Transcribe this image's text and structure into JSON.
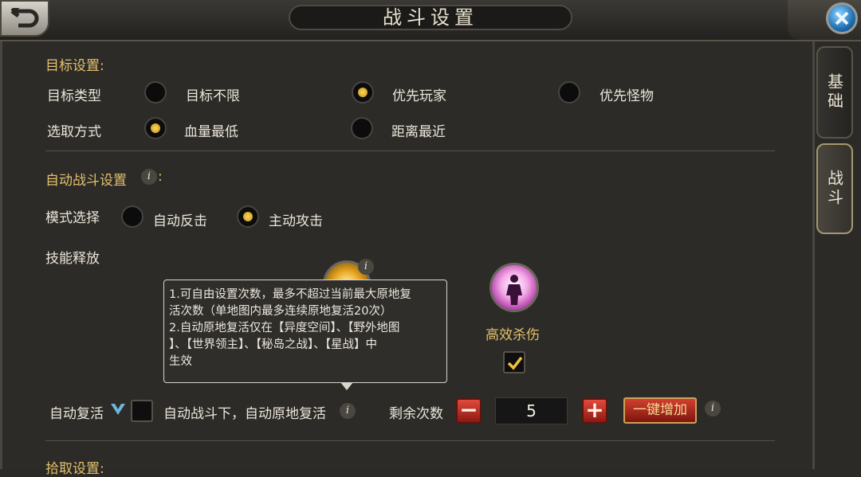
{
  "header": {
    "title": "战斗设置"
  },
  "tabs": [
    {
      "label": "基础",
      "active": false
    },
    {
      "label": "战斗",
      "active": true
    }
  ],
  "target_settings": {
    "heading": "目标设置:",
    "target_type": {
      "label": "目标类型",
      "options": [
        {
          "label": "目标不限",
          "selected": false
        },
        {
          "label": "优先玩家",
          "selected": true
        },
        {
          "label": "优先怪物",
          "selected": false
        }
      ]
    },
    "selection_mode": {
      "label": "选取方式",
      "options": [
        {
          "label": "血量最低",
          "selected": true
        },
        {
          "label": "距离最近",
          "selected": false
        }
      ]
    }
  },
  "auto_battle": {
    "heading": "自动战斗设置",
    "heading_colon": ":",
    "mode": {
      "label": "模式选择",
      "options": [
        {
          "label": "自动反击",
          "selected": false
        },
        {
          "label": "主动攻击",
          "selected": true
        }
      ]
    },
    "skills_label": "技能释放",
    "skills": [
      {
        "name": "高效杀伤",
        "checked": true
      }
    ]
  },
  "tooltip": {
    "lines": [
      "1.可自由设置次数，最多不超过当前最大原地复",
      "活次数（单地图内最多连续原地复活20次）",
      "2.自动原地复活仅在【异度空间】、【野外地图",
      "】、【世界领主】、【秘岛之战】、【星战】中",
      "生效"
    ]
  },
  "revive": {
    "label": "自动复活",
    "description": "自动战斗下，自动原地复活",
    "remaining_label": "剩余次数",
    "count": "5",
    "minus": "−",
    "plus": "+",
    "one_click": "一键增加",
    "checked": false
  },
  "pickup": {
    "heading": "拾取设置:"
  },
  "icons": {
    "info": "i",
    "back": "back-arrow-icon",
    "close": "close-x-icon",
    "vip": "vip-v-icon",
    "check": "checkmark-icon"
  },
  "colors": {
    "accent_gold": "#e3c06c",
    "radio_dot": "#ffd75a",
    "button_red": "#c8352a",
    "close_blue": "#1f6fb2"
  }
}
